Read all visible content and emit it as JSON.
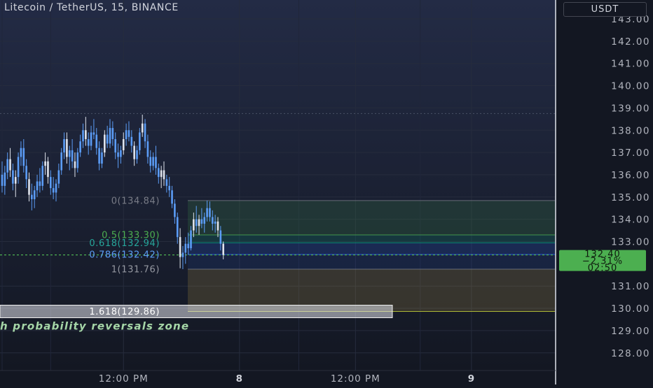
{
  "header": {
    "title": "Litecoin / TetherUS, 15, BINANCE",
    "currency": "USDT"
  },
  "colors": {
    "background": "#131722",
    "candle": "#5b9cf6",
    "candle_alt": "#dfe3ec",
    "fib_0": "#787b86",
    "fib_05": "#4caf50",
    "fib_0618": "#089981",
    "fib_0786": "#2962ff",
    "fib_1": "#787b86",
    "fib_1618": "#dfe3ec",
    "zone_text": "#a5d6a7",
    "price_label": "#4caf50"
  },
  "chart_data": {
    "type": "candlestick",
    "symbol": "Litecoin / TetherUS",
    "interval": "15",
    "exchange": "BINANCE",
    "currency": "USDT",
    "ylim": [
      127.0,
      143.3
    ],
    "y_ticks": [
      143,
      142,
      141,
      140,
      139,
      138,
      137,
      136,
      135,
      134,
      133,
      131,
      130,
      129,
      128
    ],
    "y_tick_labels": [
      "143.00",
      "142.00",
      "141.00",
      "140.00",
      "139.00",
      "138.00",
      "137.00",
      "136.00",
      "135.00",
      "134.00",
      "133.00",
      "131.00",
      "130.00",
      "129.00",
      "128.00"
    ],
    "x_labels": [
      {
        "label": "12:00 PM",
        "index": 45
      },
      {
        "label": "8",
        "index": 88
      },
      {
        "label": "12:00 PM",
        "index": 131
      },
      {
        "label": "9",
        "index": 174
      }
    ],
    "last_price": {
      "price": "132.40",
      "change": "−2.31%",
      "countdown": "02:50",
      "value": 132.4
    },
    "reference_line": 138.75,
    "fib_levels": [
      {
        "label": "0(134.84)",
        "value": 134.84
      },
      {
        "label": "0.5(133.30)",
        "value": 133.3
      },
      {
        "label": "0.618(132.94)",
        "value": 132.94
      },
      {
        "label": "0.786(132.42)",
        "value": 132.42
      },
      {
        "label": "1(131.76)",
        "value": 131.76
      },
      {
        "label": "1.618(129.86)",
        "value": 129.86
      }
    ],
    "zone_label": "h probability reversals zone",
    "ohlc": [
      [
        136.0,
        136.6,
        135.2,
        135.5
      ],
      [
        135.5,
        136.4,
        135.1,
        136.1
      ],
      [
        136.1,
        137.0,
        135.8,
        136.7
      ],
      [
        136.7,
        137.2,
        135.9,
        136.2
      ],
      [
        136.2,
        136.5,
        135.3,
        135.6
      ],
      [
        135.6,
        136.2,
        135.0,
        135.9
      ],
      [
        135.9,
        137.0,
        135.6,
        136.8
      ],
      [
        136.8,
        137.5,
        136.4,
        137.2
      ],
      [
        137.2,
        137.6,
        136.1,
        136.4
      ],
      [
        136.4,
        136.7,
        135.4,
        135.8
      ],
      [
        135.8,
        136.1,
        134.8,
        135.1
      ],
      [
        135.1,
        135.6,
        134.4,
        134.9
      ],
      [
        134.9,
        135.5,
        134.5,
        135.3
      ],
      [
        135.3,
        136.0,
        135.0,
        135.7
      ],
      [
        135.7,
        136.3,
        135.2,
        135.5
      ],
      [
        135.5,
        136.6,
        135.3,
        136.4
      ],
      [
        136.4,
        137.0,
        136.0,
        136.6
      ],
      [
        136.6,
        136.8,
        135.6,
        135.9
      ],
      [
        135.9,
        136.2,
        135.1,
        135.4
      ],
      [
        135.4,
        135.9,
        134.9,
        135.2
      ],
      [
        135.2,
        135.8,
        134.8,
        135.6
      ],
      [
        135.6,
        136.5,
        135.4,
        136.2
      ],
      [
        136.2,
        137.2,
        136.0,
        137.0
      ],
      [
        137.0,
        137.9,
        136.7,
        137.6
      ],
      [
        137.6,
        137.9,
        136.5,
        136.8
      ],
      [
        136.8,
        137.3,
        136.2,
        137.1
      ],
      [
        137.1,
        137.6,
        136.3,
        136.6
      ],
      [
        136.6,
        137.0,
        135.9,
        136.3
      ],
      [
        136.3,
        137.2,
        136.1,
        137.0
      ],
      [
        137.0,
        137.8,
        136.8,
        137.5
      ],
      [
        137.5,
        138.3,
        137.2,
        138.0
      ],
      [
        138.0,
        138.6,
        137.3,
        137.6
      ],
      [
        137.6,
        137.9,
        136.9,
        137.3
      ],
      [
        137.3,
        138.2,
        137.1,
        137.9
      ],
      [
        137.9,
        138.5,
        137.6,
        137.8
      ],
      [
        137.8,
        138.1,
        136.9,
        137.2
      ],
      [
        137.2,
        137.5,
        136.2,
        136.5
      ],
      [
        136.5,
        137.2,
        136.3,
        137.0
      ],
      [
        137.0,
        138.0,
        136.8,
        137.8
      ],
      [
        137.8,
        138.2,
        137.2,
        137.4
      ],
      [
        137.4,
        138.5,
        137.2,
        138.1
      ],
      [
        138.1,
        138.4,
        137.3,
        137.6
      ],
      [
        137.6,
        137.9,
        136.7,
        137.0
      ],
      [
        137.0,
        137.4,
        136.3,
        136.8
      ],
      [
        136.8,
        137.3,
        136.5,
        137.1
      ],
      [
        137.1,
        137.9,
        136.9,
        137.6
      ],
      [
        137.6,
        138.3,
        137.3,
        138.0
      ],
      [
        138.0,
        138.4,
        137.5,
        137.7
      ],
      [
        137.7,
        138.0,
        137.0,
        137.3
      ],
      [
        137.3,
        137.5,
        136.4,
        136.7
      ],
      [
        136.7,
        137.3,
        136.5,
        137.1
      ],
      [
        137.1,
        138.1,
        136.9,
        137.9
      ],
      [
        137.9,
        138.7,
        137.7,
        138.3
      ],
      [
        138.3,
        138.5,
        137.2,
        137.5
      ],
      [
        137.5,
        137.8,
        136.5,
        136.8
      ],
      [
        136.8,
        137.1,
        136.1,
        136.4
      ],
      [
        136.4,
        137.0,
        136.2,
        136.8
      ],
      [
        136.8,
        137.3,
        136.0,
        136.3
      ],
      [
        136.3,
        136.5,
        135.6,
        135.9
      ],
      [
        135.9,
        136.4,
        135.4,
        136.2
      ],
      [
        136.2,
        136.6,
        135.5,
        135.8
      ],
      [
        135.8,
        136.0,
        135.2,
        135.5
      ],
      [
        135.5,
        135.9,
        135.0,
        135.3
      ],
      [
        135.3,
        135.5,
        134.5,
        134.7
      ],
      [
        134.7,
        134.9,
        133.8,
        134.1
      ],
      [
        134.1,
        134.3,
        132.9,
        133.2
      ],
      [
        133.2,
        133.6,
        131.8,
        132.3
      ],
      [
        132.3,
        132.8,
        131.76,
        132.5
      ],
      [
        132.5,
        133.2,
        132.0,
        132.9
      ],
      [
        132.9,
        133.4,
        132.4,
        132.7
      ],
      [
        132.7,
        133.7,
        132.6,
        133.5
      ],
      [
        133.5,
        134.3,
        133.2,
        134.0
      ],
      [
        134.0,
        134.6,
        133.4,
        133.7
      ],
      [
        133.7,
        134.2,
        133.3,
        134.0
      ],
      [
        134.0,
        134.5,
        133.6,
        133.8
      ],
      [
        133.8,
        134.3,
        133.4,
        134.1
      ],
      [
        134.1,
        134.84,
        133.9,
        134.5
      ],
      [
        134.5,
        134.8,
        133.9,
        134.1
      ],
      [
        134.1,
        134.4,
        133.5,
        133.8
      ],
      [
        133.8,
        134.2,
        133.4,
        133.9
      ],
      [
        133.9,
        134.1,
        133.2,
        133.5
      ],
      [
        133.5,
        133.7,
        132.6,
        132.9
      ],
      [
        132.9,
        133.0,
        132.2,
        132.4
      ]
    ]
  }
}
